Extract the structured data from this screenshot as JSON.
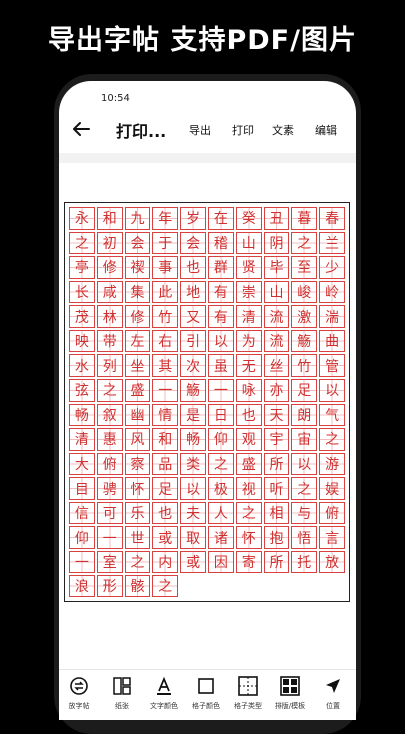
{
  "headline": "导出字帖 支持PDF/图片",
  "status": {
    "time": "10:54"
  },
  "appbar": {
    "title": "打印...",
    "actions": [
      "导出",
      "打印",
      "文素",
      "编辑"
    ]
  },
  "practice_sheet": {
    "ink_color": "#d03030",
    "rows": [
      "永和九年岁在癸丑暮春之",
      "初会于会稽山阴之兰亭修",
      "禊事也群贤毕至少长咸集",
      "此地有崇山峻岭茂林修竹",
      "又有清流激湍映带左右引",
      "以为流觞曲水列坐其次虽",
      "无丝竹管弦之盛一觞一咏",
      "亦足以畅叙幽情是日也天",
      "朗气清惠风和畅仰观宇宙",
      "之大俯察品类之盛所以游",
      "目骋怀足以极视听之娱信",
      "可乐也夫人之相与俯仰一",
      "世或取诸怀抱悟言一室之",
      "内或因寄所托放浪形骸之"
    ]
  },
  "toolbar": {
    "items": [
      {
        "icon": "swap-icon",
        "label": "放字帖"
      },
      {
        "icon": "layout-icon",
        "label": "纸张"
      },
      {
        "icon": "text-color-icon",
        "label": "文字颜色"
      },
      {
        "icon": "square-icon",
        "label": "格子颜色"
      },
      {
        "icon": "grid-type-icon",
        "label": "格子类型"
      },
      {
        "icon": "layout-grid-icon",
        "label": "排版/模板"
      },
      {
        "icon": "send-icon",
        "label": "位置"
      }
    ]
  }
}
